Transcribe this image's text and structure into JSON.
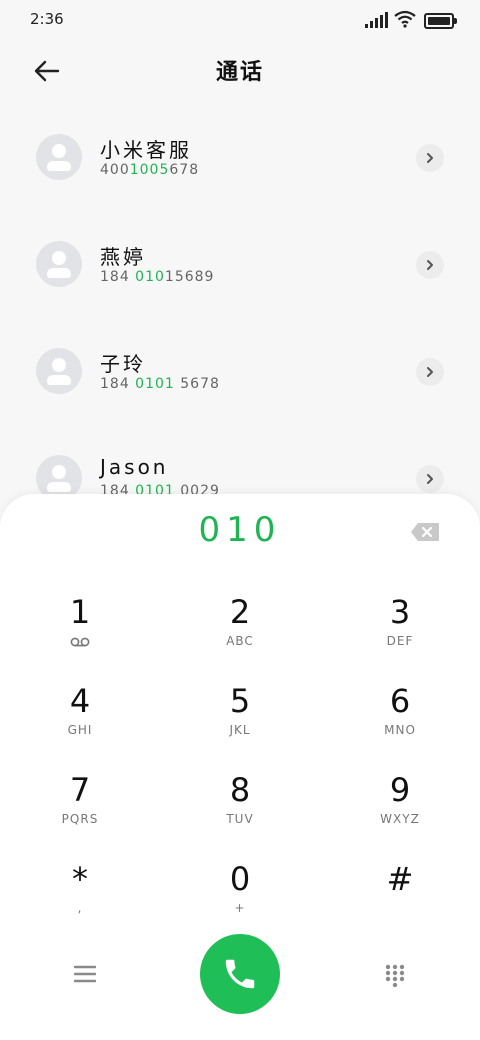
{
  "status_bar": {
    "time": "2:36"
  },
  "header": {
    "title": "通话"
  },
  "contacts": [
    {
      "name": "小米客服",
      "number_pre": "400",
      "number_hl": "1005",
      "number_post": "678"
    },
    {
      "name": "燕婷",
      "number_pre": "184 ",
      "number_hl": "010",
      "number_post": "15689"
    },
    {
      "name": "子玲",
      "number_pre": "184 ",
      "number_hl": "0101",
      "number_post": " 5678"
    },
    {
      "name": "Jason",
      "number_pre": "184 ",
      "number_hl": "0101",
      "number_post": " 0029"
    }
  ],
  "dialpad": {
    "entered": "010",
    "keys": [
      {
        "digit": "1",
        "letters": ""
      },
      {
        "digit": "2",
        "letters": "ABC"
      },
      {
        "digit": "3",
        "letters": "DEF"
      },
      {
        "digit": "4",
        "letters": "GHI"
      },
      {
        "digit": "5",
        "letters": "JKL"
      },
      {
        "digit": "6",
        "letters": "MNO"
      },
      {
        "digit": "7",
        "letters": "PQRS"
      },
      {
        "digit": "8",
        "letters": "TUV"
      },
      {
        "digit": "9",
        "letters": "WXYZ"
      },
      {
        "digit": "*",
        "letters": ","
      },
      {
        "digit": "0",
        "letters": "+"
      },
      {
        "digit": "#",
        "letters": ""
      }
    ]
  },
  "colors": {
    "accent": "#1fb453",
    "call_button": "#1fbe57",
    "background": "#f7f7f7"
  }
}
